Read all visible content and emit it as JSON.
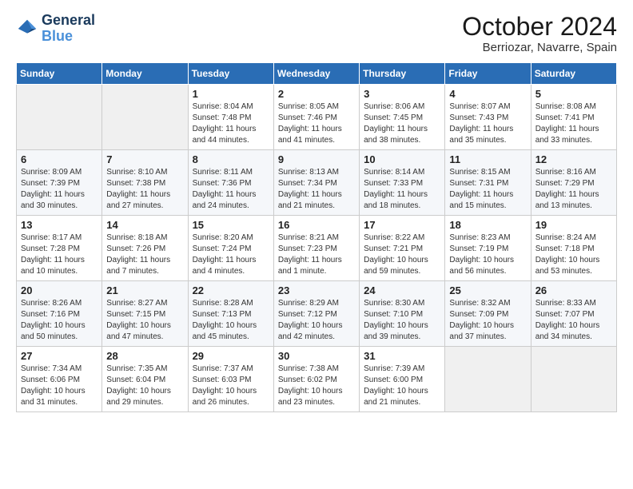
{
  "logo": {
    "line1": "General",
    "line2": "Blue"
  },
  "title": "October 2024",
  "subtitle": "Berriozar, Navarre, Spain",
  "headers": [
    "Sunday",
    "Monday",
    "Tuesday",
    "Wednesday",
    "Thursday",
    "Friday",
    "Saturday"
  ],
  "rows": [
    [
      {
        "day": "",
        "info": ""
      },
      {
        "day": "",
        "info": ""
      },
      {
        "day": "1",
        "info": "Sunrise: 8:04 AM\nSunset: 7:48 PM\nDaylight: 11 hours and 44 minutes."
      },
      {
        "day": "2",
        "info": "Sunrise: 8:05 AM\nSunset: 7:46 PM\nDaylight: 11 hours and 41 minutes."
      },
      {
        "day": "3",
        "info": "Sunrise: 8:06 AM\nSunset: 7:45 PM\nDaylight: 11 hours and 38 minutes."
      },
      {
        "day": "4",
        "info": "Sunrise: 8:07 AM\nSunset: 7:43 PM\nDaylight: 11 hours and 35 minutes."
      },
      {
        "day": "5",
        "info": "Sunrise: 8:08 AM\nSunset: 7:41 PM\nDaylight: 11 hours and 33 minutes."
      }
    ],
    [
      {
        "day": "6",
        "info": "Sunrise: 8:09 AM\nSunset: 7:39 PM\nDaylight: 11 hours and 30 minutes."
      },
      {
        "day": "7",
        "info": "Sunrise: 8:10 AM\nSunset: 7:38 PM\nDaylight: 11 hours and 27 minutes."
      },
      {
        "day": "8",
        "info": "Sunrise: 8:11 AM\nSunset: 7:36 PM\nDaylight: 11 hours and 24 minutes."
      },
      {
        "day": "9",
        "info": "Sunrise: 8:13 AM\nSunset: 7:34 PM\nDaylight: 11 hours and 21 minutes."
      },
      {
        "day": "10",
        "info": "Sunrise: 8:14 AM\nSunset: 7:33 PM\nDaylight: 11 hours and 18 minutes."
      },
      {
        "day": "11",
        "info": "Sunrise: 8:15 AM\nSunset: 7:31 PM\nDaylight: 11 hours and 15 minutes."
      },
      {
        "day": "12",
        "info": "Sunrise: 8:16 AM\nSunset: 7:29 PM\nDaylight: 11 hours and 13 minutes."
      }
    ],
    [
      {
        "day": "13",
        "info": "Sunrise: 8:17 AM\nSunset: 7:28 PM\nDaylight: 11 hours and 10 minutes."
      },
      {
        "day": "14",
        "info": "Sunrise: 8:18 AM\nSunset: 7:26 PM\nDaylight: 11 hours and 7 minutes."
      },
      {
        "day": "15",
        "info": "Sunrise: 8:20 AM\nSunset: 7:24 PM\nDaylight: 11 hours and 4 minutes."
      },
      {
        "day": "16",
        "info": "Sunrise: 8:21 AM\nSunset: 7:23 PM\nDaylight: 11 hours and 1 minute."
      },
      {
        "day": "17",
        "info": "Sunrise: 8:22 AM\nSunset: 7:21 PM\nDaylight: 10 hours and 59 minutes."
      },
      {
        "day": "18",
        "info": "Sunrise: 8:23 AM\nSunset: 7:19 PM\nDaylight: 10 hours and 56 minutes."
      },
      {
        "day": "19",
        "info": "Sunrise: 8:24 AM\nSunset: 7:18 PM\nDaylight: 10 hours and 53 minutes."
      }
    ],
    [
      {
        "day": "20",
        "info": "Sunrise: 8:26 AM\nSunset: 7:16 PM\nDaylight: 10 hours and 50 minutes."
      },
      {
        "day": "21",
        "info": "Sunrise: 8:27 AM\nSunset: 7:15 PM\nDaylight: 10 hours and 47 minutes."
      },
      {
        "day": "22",
        "info": "Sunrise: 8:28 AM\nSunset: 7:13 PM\nDaylight: 10 hours and 45 minutes."
      },
      {
        "day": "23",
        "info": "Sunrise: 8:29 AM\nSunset: 7:12 PM\nDaylight: 10 hours and 42 minutes."
      },
      {
        "day": "24",
        "info": "Sunrise: 8:30 AM\nSunset: 7:10 PM\nDaylight: 10 hours and 39 minutes."
      },
      {
        "day": "25",
        "info": "Sunrise: 8:32 AM\nSunset: 7:09 PM\nDaylight: 10 hours and 37 minutes."
      },
      {
        "day": "26",
        "info": "Sunrise: 8:33 AM\nSunset: 7:07 PM\nDaylight: 10 hours and 34 minutes."
      }
    ],
    [
      {
        "day": "27",
        "info": "Sunrise: 7:34 AM\nSunset: 6:06 PM\nDaylight: 10 hours and 31 minutes."
      },
      {
        "day": "28",
        "info": "Sunrise: 7:35 AM\nSunset: 6:04 PM\nDaylight: 10 hours and 29 minutes."
      },
      {
        "day": "29",
        "info": "Sunrise: 7:37 AM\nSunset: 6:03 PM\nDaylight: 10 hours and 26 minutes."
      },
      {
        "day": "30",
        "info": "Sunrise: 7:38 AM\nSunset: 6:02 PM\nDaylight: 10 hours and 23 minutes."
      },
      {
        "day": "31",
        "info": "Sunrise: 7:39 AM\nSunset: 6:00 PM\nDaylight: 10 hours and 21 minutes."
      },
      {
        "day": "",
        "info": ""
      },
      {
        "day": "",
        "info": ""
      }
    ]
  ]
}
